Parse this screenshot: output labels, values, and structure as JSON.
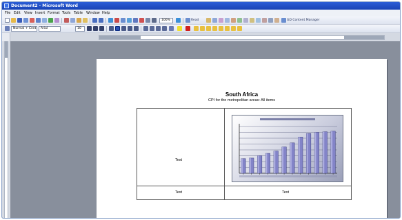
{
  "window": {
    "title": "Document2 - Microsoft Word"
  },
  "menu": [
    "File",
    "Edit",
    "View",
    "Insert",
    "Format",
    "Tools",
    "Table",
    "Window",
    "Help"
  ],
  "toolbar1": {
    "zoom": "100%",
    "read_label": "Read",
    "gd_label": "GD Content Manager"
  },
  "toolbar2": {
    "style": "Normal + Cent",
    "font": "Arial",
    "size": "10"
  },
  "document": {
    "title": "South Africa",
    "subtitle": "CPI for the metropolitan areas: All items",
    "cells": {
      "top_left": "Text",
      "bottom_left": "Text",
      "bottom_right": "Text"
    }
  },
  "chart_data": {
    "type": "bar",
    "values": [
      25,
      26,
      30,
      34,
      38,
      45,
      52,
      62,
      68,
      70,
      71,
      72
    ],
    "ylim": [
      0,
      80
    ],
    "grid": true,
    "bar_color": "#8384c8"
  },
  "colors": {
    "titlebar": "#2356cc",
    "page": "#ffffff",
    "workspace": "#888f9c",
    "toolbar": "#e4e8f1"
  }
}
